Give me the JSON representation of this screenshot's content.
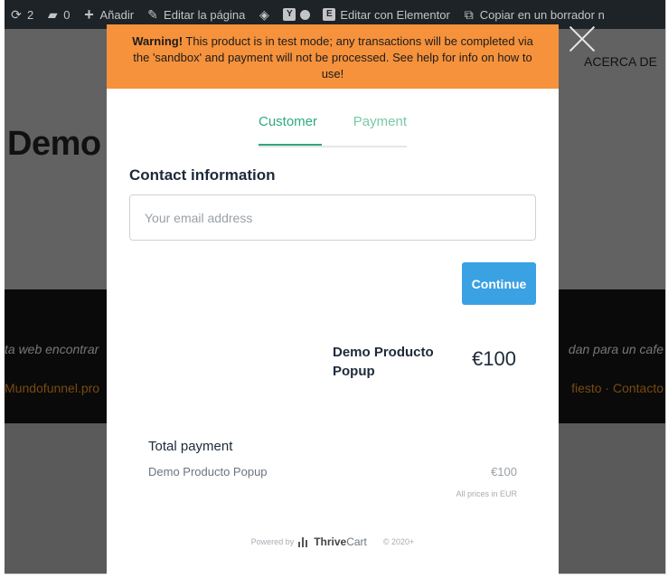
{
  "adminbar": {
    "updates_count": "2",
    "comments_count": "0",
    "add_label": "Añadir",
    "edit_page_label": "Editar la página",
    "edit_elementor_label": "Editar con Elementor",
    "copy_draft_label": "Copiar en un borrador n"
  },
  "site": {
    "menu_item": "ACERCA DE",
    "page_title": "Demo",
    "band_text_left": "ta web encontrar",
    "band_text_right": "dan para un cafe",
    "band_link_left": "Mundofunnel.pro",
    "band_link_right": "fiesto · Contacto"
  },
  "modal": {
    "warning_bold": "Warning!",
    "warning_text": " This product is in test mode; any transactions will be completed via the 'sandbox' and payment will not be processed. See help for info on how to use!",
    "tabs": [
      {
        "label": "Customer",
        "active": true
      },
      {
        "label": "Payment",
        "active": false
      }
    ],
    "contact_title": "Contact information",
    "email_placeholder": "Your email address",
    "continue_label": "Continue",
    "product": {
      "name": "Demo Producto Popup",
      "price": "€100"
    },
    "total": {
      "title": "Total payment",
      "item_name": "Demo Producto Popup",
      "item_price": "€100",
      "currency_note": "All prices in EUR"
    },
    "footer": {
      "powered_by": "Powered by",
      "brand_bold": "Thrive",
      "brand_rest": "Cart",
      "year": "© 2020+"
    }
  },
  "colors": {
    "warning": "#f6923c",
    "accent_green": "#2eaa7c",
    "button_blue": "#3aa1e3"
  },
  "icons": [
    "refresh-icon",
    "comment-icon",
    "plus-icon",
    "pencil-icon",
    "diamond-icon",
    "yoast-icon",
    "status-dot-icon",
    "elementor-icon",
    "copy-icon",
    "close-icon",
    "thrivecart-logo-icon"
  ]
}
